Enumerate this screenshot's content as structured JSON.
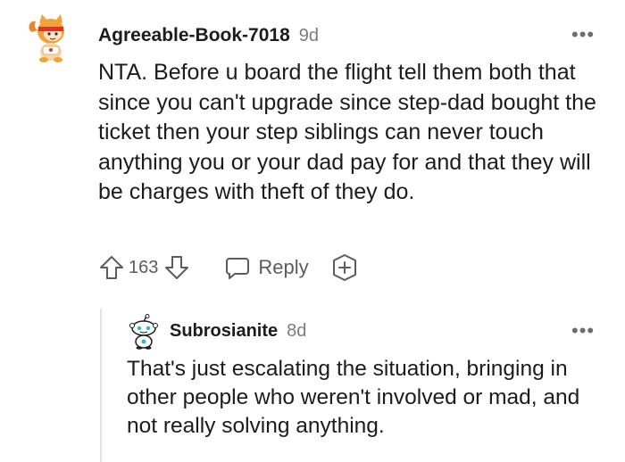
{
  "comments": [
    {
      "username": "Agreeable-Book-7018",
      "age": "9d",
      "body": "NTA. Before u board the flight tell them both that since you can't upgrade since step-dad bought the ticket then your step siblings can never touch anything you or your dad pay for and that they will be charges with theft of they do.",
      "score": "163",
      "reply_label": "Reply",
      "more_label": "•••",
      "avatar_icon": "cat-avatar-icon"
    },
    {
      "username": "Subrosianite",
      "age": "8d",
      "body": "That's just escalating the situation, bringing in other people who weren't involved or mad, and not really solving anything.",
      "more_label": "•••",
      "avatar_icon": "snoo-avatar-icon"
    }
  ],
  "colors": {
    "text": "#1c1c1c",
    "meta": "#7c7c7c",
    "icon": "#5c5c5c",
    "thread_line": "#e4e4e4"
  }
}
